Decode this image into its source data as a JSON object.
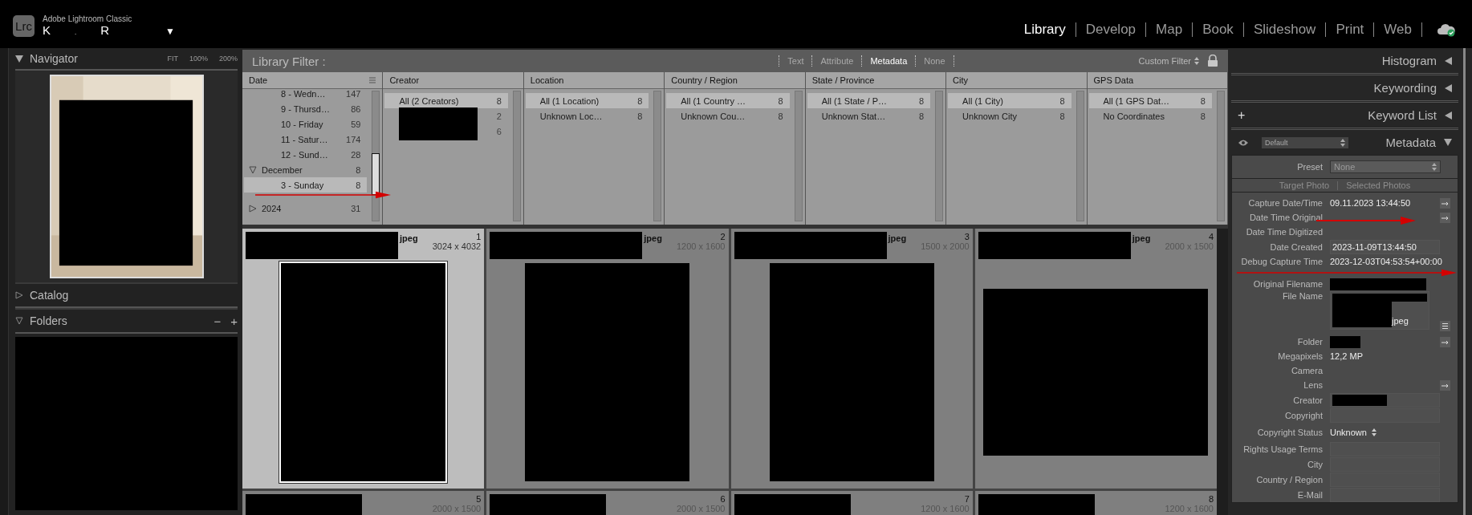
{
  "app": {
    "logo": "Lrc",
    "name": "Adobe Lightroom Classic",
    "user_parts": [
      "K",
      ".",
      "R"
    ],
    "menu_caret": "▼"
  },
  "modules": [
    {
      "label": "Library",
      "selected": true
    },
    {
      "label": "Develop",
      "selected": false
    },
    {
      "label": "Map",
      "selected": false
    },
    {
      "label": "Book",
      "selected": false
    },
    {
      "label": "Slideshow",
      "selected": false
    },
    {
      "label": "Print",
      "selected": false
    },
    {
      "label": "Web",
      "selected": false
    }
  ],
  "left_panel": {
    "navigator": {
      "title": "Navigator",
      "zooms": [
        "FIT",
        "100%",
        "200%"
      ]
    },
    "sections": [
      {
        "title": "Catalog",
        "expanded": false
      },
      {
        "title": "Folders",
        "expanded": true,
        "actions": [
          "−",
          "+"
        ]
      }
    ]
  },
  "library_filter": {
    "title": "Library Filter :",
    "tabs": [
      {
        "label": "Text",
        "selected": false
      },
      {
        "label": "Attribute",
        "selected": false
      },
      {
        "label": "Metadata",
        "selected": true
      },
      {
        "label": "None",
        "selected": false
      }
    ],
    "preset": "Custom Filter",
    "date_column": {
      "title": "Date",
      "items": [
        {
          "kind": "day",
          "label": "8 - Wedn…",
          "count": "147",
          "selected": false
        },
        {
          "kind": "day",
          "label": "9 - Thursd…",
          "count": "86",
          "selected": false
        },
        {
          "kind": "day",
          "label": "10 - Friday",
          "count": "59",
          "selected": false
        },
        {
          "kind": "day",
          "label": "11 - Satur…",
          "count": "174",
          "selected": false
        },
        {
          "kind": "day",
          "label": "12 - Sund…",
          "count": "28",
          "selected": false
        },
        {
          "kind": "month",
          "label": "December",
          "count": "8",
          "selected": false,
          "expanded": true,
          "children": [
            {
              "kind": "day",
              "label": "3 - Sunday",
              "count": "8",
              "selected": true
            }
          ]
        },
        {
          "kind": "year",
          "label": "2024",
          "count": "31",
          "selected": false,
          "expanded": false
        }
      ]
    },
    "columns": [
      {
        "title": "Creator",
        "items": [
          {
            "label": "All (2 Creators)",
            "count": "8",
            "selected": true
          },
          {
            "redacted": true,
            "count": "2",
            "selected": false
          },
          {
            "redacted": true,
            "count": "6",
            "selected": false
          }
        ]
      },
      {
        "title": "Location",
        "items": [
          {
            "label": "All (1 Location)",
            "count": "8",
            "selected": true
          },
          {
            "label": "Unknown Loc…",
            "count": "8",
            "selected": false
          }
        ]
      },
      {
        "title": "Country / Region",
        "items": [
          {
            "label": "All (1 Country …",
            "count": "8",
            "selected": true
          },
          {
            "label": "Unknown Cou…",
            "count": "8",
            "selected": false
          }
        ]
      },
      {
        "title": "State / Province",
        "items": [
          {
            "label": "All (1 State / P…",
            "count": "8",
            "selected": true
          },
          {
            "label": "Unknown Stat…",
            "count": "8",
            "selected": false
          }
        ]
      },
      {
        "title": "City",
        "items": [
          {
            "label": "All (1 City)",
            "count": "8",
            "selected": true
          },
          {
            "label": "Unknown City",
            "count": "8",
            "selected": false
          }
        ]
      },
      {
        "title": "GPS Data",
        "items": [
          {
            "label": "All (1 GPS Dat…",
            "count": "8",
            "selected": true
          },
          {
            "label": "No Coordinates",
            "count": "8",
            "selected": false
          }
        ]
      }
    ]
  },
  "grid": [
    {
      "ext": "jpeg",
      "index": "1",
      "size": "3024 x 4032",
      "landscape": false,
      "selected": true
    },
    {
      "ext": "jpeg",
      "index": "2",
      "size": "1200 x 1600",
      "landscape": false,
      "selected": false
    },
    {
      "ext": "jpeg",
      "index": "3",
      "size": "1500 x 2000",
      "landscape": false,
      "selected": false
    },
    {
      "ext": "jpeg",
      "index": "4",
      "size": "2000 x 1500",
      "landscape": true,
      "selected": false
    },
    {
      "index": "5",
      "size": "2000 x 1500",
      "selected": false
    },
    {
      "index": "6",
      "size": "2000 x 1500",
      "selected": false
    },
    {
      "index": "7",
      "size": "1200 x 1600",
      "selected": false
    },
    {
      "index": "8",
      "size": "1200 x 1600",
      "selected": false
    }
  ],
  "right_panel": {
    "panels": [
      {
        "title": "Histogram"
      },
      {
        "title": "Keywording"
      },
      {
        "title": "Keyword List",
        "add": "+"
      }
    ],
    "metadata": {
      "title": "Metadata",
      "view": "Default",
      "preset_label": "Preset",
      "preset": "None",
      "targets": [
        "Target Photo",
        "Selected Photos"
      ],
      "fields": [
        {
          "label": "Capture Date/Time",
          "kind": "plain",
          "value": "09.11.2023 13:44:50",
          "arrow": true
        },
        {
          "label": "Date Time Original",
          "kind": "plain",
          "arrow": true
        },
        {
          "label": "Date Time Digitized",
          "kind": "plain"
        },
        {
          "label": "Date Created",
          "kind": "box",
          "value": "2023-11-09T13:44:50"
        },
        {
          "label": "Debug Capture Time",
          "kind": "plain",
          "value": "2023-12-03T04:53:54+00:00"
        },
        {
          "label": "Original Filename",
          "kind": "plain",
          "redacted": true
        },
        {
          "label": "File Name",
          "kind": "tall",
          "redacted": true,
          "value": "jpeg",
          "list": true
        },
        {
          "label": "Folder",
          "kind": "plain",
          "redacted": true,
          "arrow": true
        },
        {
          "label": "Megapixels",
          "kind": "plain",
          "value": "12,2 MP"
        },
        {
          "label": "Camera",
          "kind": "plain"
        },
        {
          "label": "Lens",
          "kind": "plain",
          "arrow": true
        },
        {
          "label": "Creator",
          "kind": "box",
          "redacted": true
        },
        {
          "label": "Copyright",
          "kind": "box"
        },
        {
          "label": "Copyright Status",
          "kind": "select",
          "value": "Unknown"
        },
        {
          "label": "Rights Usage Terms",
          "kind": "box"
        },
        {
          "label": "City",
          "kind": "box"
        },
        {
          "label": "Country / Region",
          "kind": "box"
        },
        {
          "label": "E-Mail",
          "kind": "box"
        }
      ]
    }
  }
}
